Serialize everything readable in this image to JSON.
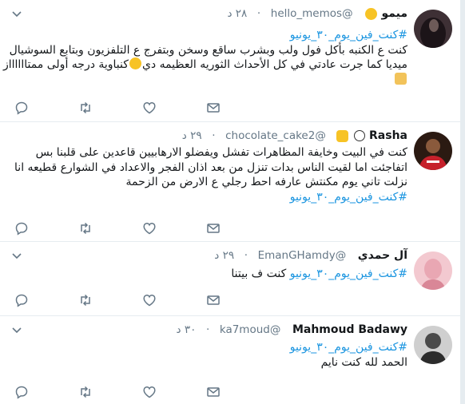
{
  "tweets": [
    {
      "name": "ميمو",
      "handle": "@hello_memos",
      "time": "٢٨ د",
      "sep": "·",
      "hashtag": "#كنت_فين_يوم_٣٠_يونيو",
      "lines": [
        "كنت ع الكنبه بأكل فول ولب وبشرب ساقع وسخن وبتفرج ع التلفزيون وبتابع السوشيال",
        "ميديا كما جرت عادتي في كل الأحداث الثوريه العظيمه دي",
        "كنباوية درجه أولى ممتااااااز"
      ],
      "avatar_icon": "avatar-hijab-silhouette",
      "name_emoji": "flushed-face-emoji",
      "inline_emoji": "sunglasses-face-emoji",
      "tail_emoji": "victory-hand-emoji"
    },
    {
      "name": "Rasha",
      "handle": "@chocolate_cake2",
      "time": "٢٩ د",
      "sep": "·",
      "lines": [
        "كنت في البيت وخايفة المظاهرات تفشل ويفضلو الارهابيين قاعدين على قلبنا بس",
        "اتفاجئت اما لقيت الناس بدات تنزل من بعد اذان الفجر والاعداد في الشوارع قطيعه انا",
        "نزلت تاني يوم مكنتش عارفه احط رجلي ع الارض من الزحمة"
      ],
      "hashtag": "#كنت_فين_يوم_٣٠_يونيو",
      "avatar_icon": "avatar-red-jersey",
      "name_emoji": "soccer-ball-emoji",
      "name_emoji2": "flexed-biceps-emoji"
    },
    {
      "name": "آل حمدي",
      "handle": "@EmanGHamdy",
      "time": "٢٩ د",
      "sep": "·",
      "hashtag": "#كنت_فين_يوم_٣٠_يونيو",
      "text": "كنت ف بيتنا",
      "avatar_icon": "avatar-pink-portrait"
    },
    {
      "name": "Mahmoud Badawy",
      "handle": "@ka7moud",
      "time": "٣٠ د",
      "sep": "·",
      "hashtag": "#كنت_فين_يوم_٣٠_يونيو",
      "text": "الحمد لله  كنت نايم",
      "avatar_icon": "avatar-grayscale-man"
    }
  ],
  "action_icons": [
    "reply-icon",
    "retweet-icon",
    "like-icon",
    "direct-message-icon"
  ],
  "colors": {
    "hashtag": "#1b95e0",
    "icon": "#657786",
    "divider": "#e6ecf0"
  }
}
